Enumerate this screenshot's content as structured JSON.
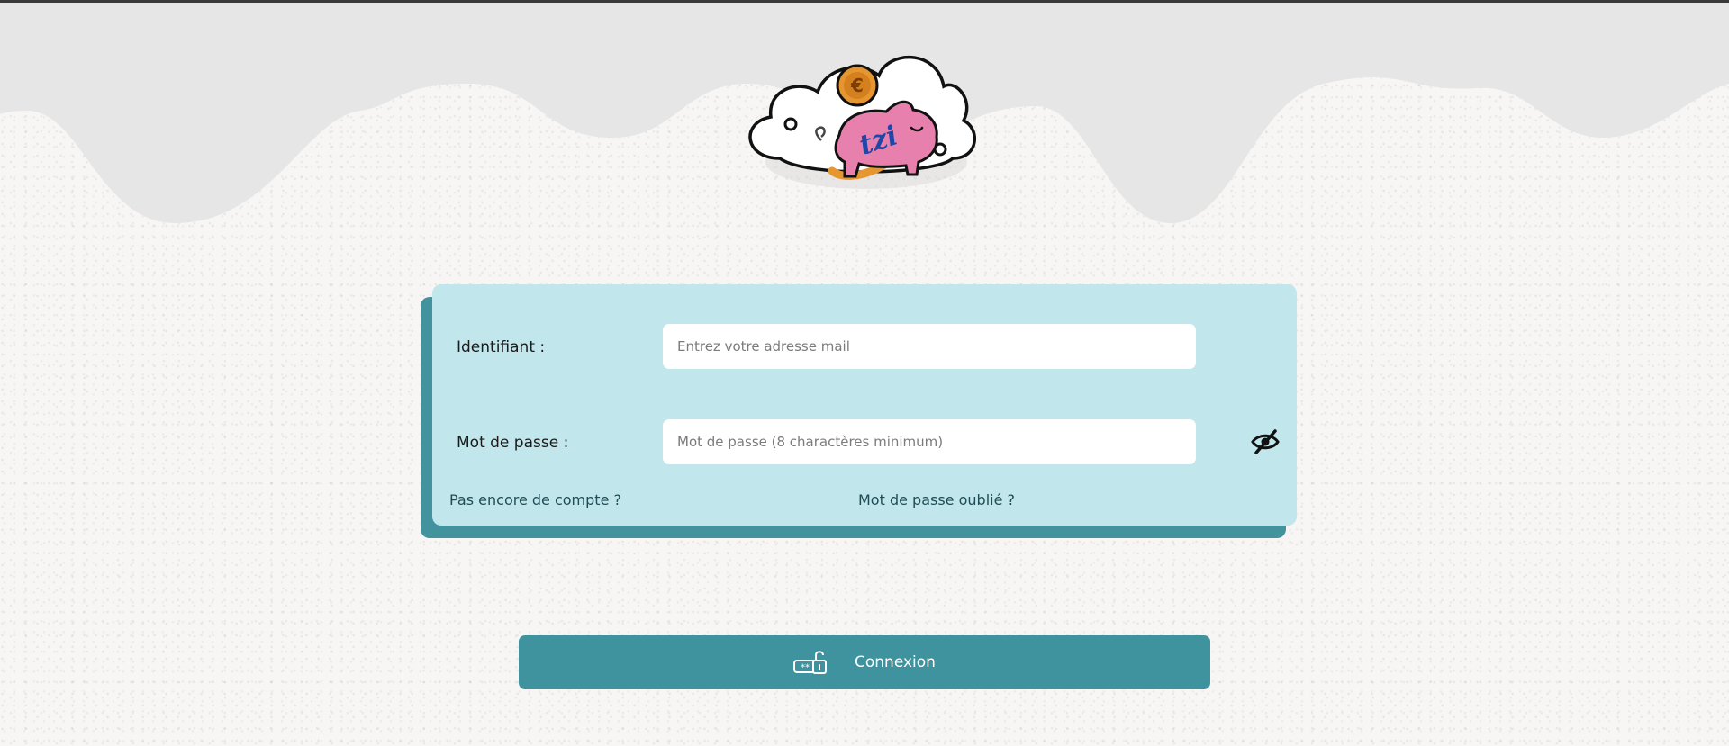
{
  "form": {
    "identifier_label": "Identifiant :",
    "identifier_placeholder": "Entrez votre adresse mail",
    "password_label": "Mot de passe :",
    "password_placeholder": "Mot de passe (8 charactères minimum)",
    "signup_link": "Pas encore de compte ?",
    "forgot_link": "Mot de passe oublié ?"
  },
  "connect_button": {
    "label": "Connexion"
  },
  "logo": {
    "text": "tzi",
    "coin_symbol": "€"
  },
  "icons": {
    "password_toggle": "eye-slash-icon",
    "connect": "password-unlock-icon",
    "logo": "piggy-bank-icon"
  },
  "colors": {
    "page_background": "#f8f6f5",
    "wave_gray": "#e6e6e6",
    "card_background": "#c1e6eb",
    "card_shadow": "#42939e",
    "button": "#3f939e",
    "piggy_pink": "#e880ad",
    "coin_orange": "#e6962e"
  }
}
